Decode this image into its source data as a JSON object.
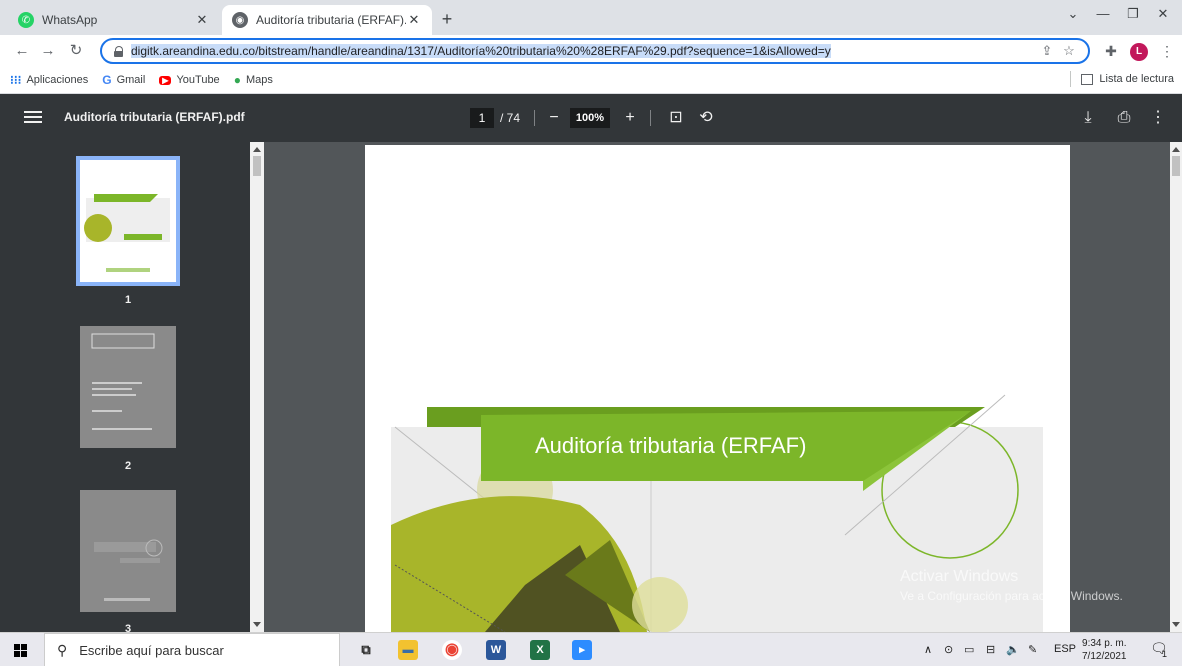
{
  "tabs": [
    {
      "title": "WhatsApp",
      "active": false
    },
    {
      "title": "Auditoría tributaria (ERFAF).pdf",
      "active": true
    }
  ],
  "toolbar": {
    "url": "digitk.areandina.edu.co/bitstream/handle/areandina/1317/Auditoría%20tributaria%20%28ERFAF%29.pdf?sequence=1&isAllowed=y",
    "avatar_letter": "L"
  },
  "bookmarks": {
    "items": [
      {
        "label": "Aplicaciones",
        "icon": "apps-grid-icon",
        "color": "#1a73e8"
      },
      {
        "label": "Gmail",
        "icon": "google-icon",
        "color": "#4285f4"
      },
      {
        "label": "YouTube",
        "icon": "youtube-icon",
        "color": "#ff0000"
      },
      {
        "label": "Maps",
        "icon": "maps-pin-icon",
        "color": "#34a853"
      }
    ],
    "reading_list": "Lista de lectura"
  },
  "pdf": {
    "title": "Auditoría tributaria (ERFAF).pdf",
    "current_page": "1",
    "page_count": "/ 74",
    "zoom": "100%",
    "cover_heading": "Auditoría tributaria (ERFAF)",
    "thumbnails": [
      "1",
      "2",
      "3"
    ]
  },
  "watermark": {
    "line1": "Activar Windows",
    "line2": "Ve a Configuración para activar Windows."
  },
  "taskbar": {
    "search_placeholder": "Escribe aquí para buscar",
    "language": "ESP",
    "time": "9:34 p. m.",
    "date": "7/12/2021",
    "notification_count": "1"
  },
  "colors": {
    "accent": "#1a73e8",
    "pdf_toolbar": "#323639",
    "cover_green": "#7cb629",
    "cover_olive": "#a8b52a"
  }
}
